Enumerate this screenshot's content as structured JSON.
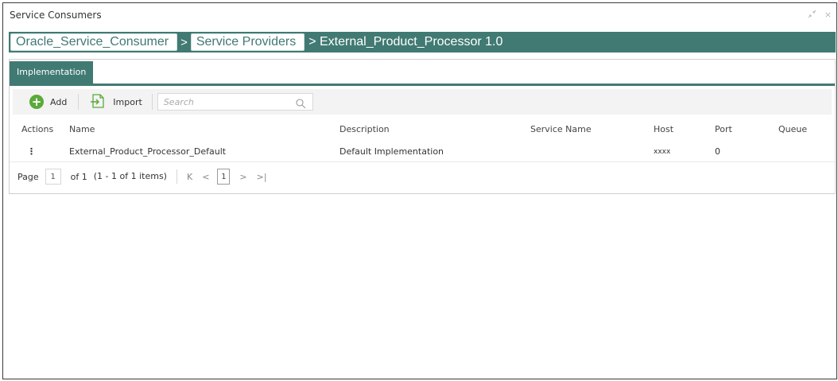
{
  "window": {
    "title": "Service Consumers",
    "minimize_label": "",
    "close_label": "×"
  },
  "breadcrumb": {
    "items": [
      "Oracle_Service_Consumer",
      "Service Providers"
    ],
    "separator": ">",
    "current": "> External_Product_Processor 1.0"
  },
  "tabs": [
    {
      "label": "Implementation",
      "active": true
    }
  ],
  "toolbar": {
    "add_label": "Add",
    "import_label": "Import",
    "search_placeholder": "Search",
    "search_value": ""
  },
  "table": {
    "columns": [
      "Actions",
      "Name",
      "Description",
      "Service Name",
      "Host",
      "Port",
      "Queue"
    ],
    "rows": [
      {
        "actions": "⋮",
        "name": "External_Product_Processor_Default",
        "description": "Default Implementation",
        "service_name": "",
        "host": "xxxx",
        "port": "0",
        "queue": ""
      }
    ]
  },
  "pager": {
    "page_label": "Page",
    "page_value": "1",
    "of_text": "of 1",
    "items_text": "(1 - 1 of 1 items)",
    "current_page": "1"
  },
  "colors": {
    "accent": "#417a73",
    "add_green": "#5aaa3a"
  }
}
